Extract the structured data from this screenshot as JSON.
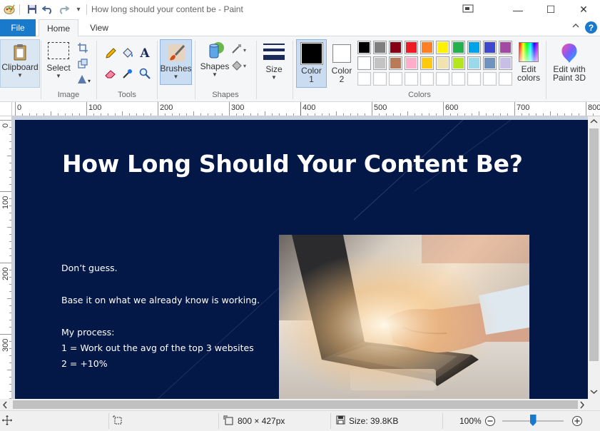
{
  "window": {
    "title": "How long should your content be - Paint",
    "minimize_glyph": "—",
    "maximize_glyph": "☐",
    "close_glyph": "✕"
  },
  "tabs": {
    "file": "File",
    "home": "Home",
    "view": "View"
  },
  "ribbon": {
    "clipboard": "Clipboard",
    "select": "Select",
    "image_group": "Image",
    "tools_group": "Tools",
    "brushes": "Brushes",
    "shapes": "Shapes",
    "shapes_group": "Shapes",
    "size": "Size",
    "color1": "Color\n1",
    "color1_a": "Color",
    "color1_b": "1",
    "color2_a": "Color",
    "color2_b": "2",
    "colors_group": "Colors",
    "edit_colors_a": "Edit",
    "edit_colors_b": "colors",
    "paint3d_a": "Edit with",
    "paint3d_b": "Paint 3D",
    "text_tool_glyph": "A",
    "help_glyph": "?",
    "collapse_glyph": "^"
  },
  "palette": {
    "row1": [
      "#000000",
      "#7f7f7f",
      "#880015",
      "#ed1c24",
      "#ff7f27",
      "#fff200",
      "#22b14c",
      "#00a2e8",
      "#3f48cc",
      "#a349a4"
    ],
    "row2": [
      "#ffffff",
      "#c3c3c3",
      "#b97a57",
      "#ffaec9",
      "#ffc90e",
      "#efe4b0",
      "#b5e61d",
      "#99d9ea",
      "#7092be",
      "#c8bfe7"
    ],
    "row3": [
      "#ffffff",
      "#ffffff",
      "#ffffff",
      "#ffffff",
      "#ffffff",
      "#ffffff",
      "#ffffff",
      "#ffffff",
      "#ffffff",
      "#ffffff"
    ],
    "color1_value": "#000000",
    "color2_value": "#ffffff"
  },
  "ruler": {
    "top_labels": [
      "0",
      "100",
      "200",
      "300",
      "400",
      "500",
      "600",
      "700",
      "800"
    ],
    "left_labels": [
      "0",
      "100",
      "200",
      "300"
    ]
  },
  "canvas": {
    "background": "#041848",
    "title": "How Long Should Your Content Be?",
    "lines": [
      "Don’t guess.",
      "Base it on what we already know is working.",
      "My process:",
      "1 = Work out the avg of the top 3 websites",
      "2 = +10%"
    ]
  },
  "status": {
    "dimensions": "800 × 427px",
    "size": "Size: 39.8KB",
    "zoom": "100%",
    "zoom_level": 100
  }
}
